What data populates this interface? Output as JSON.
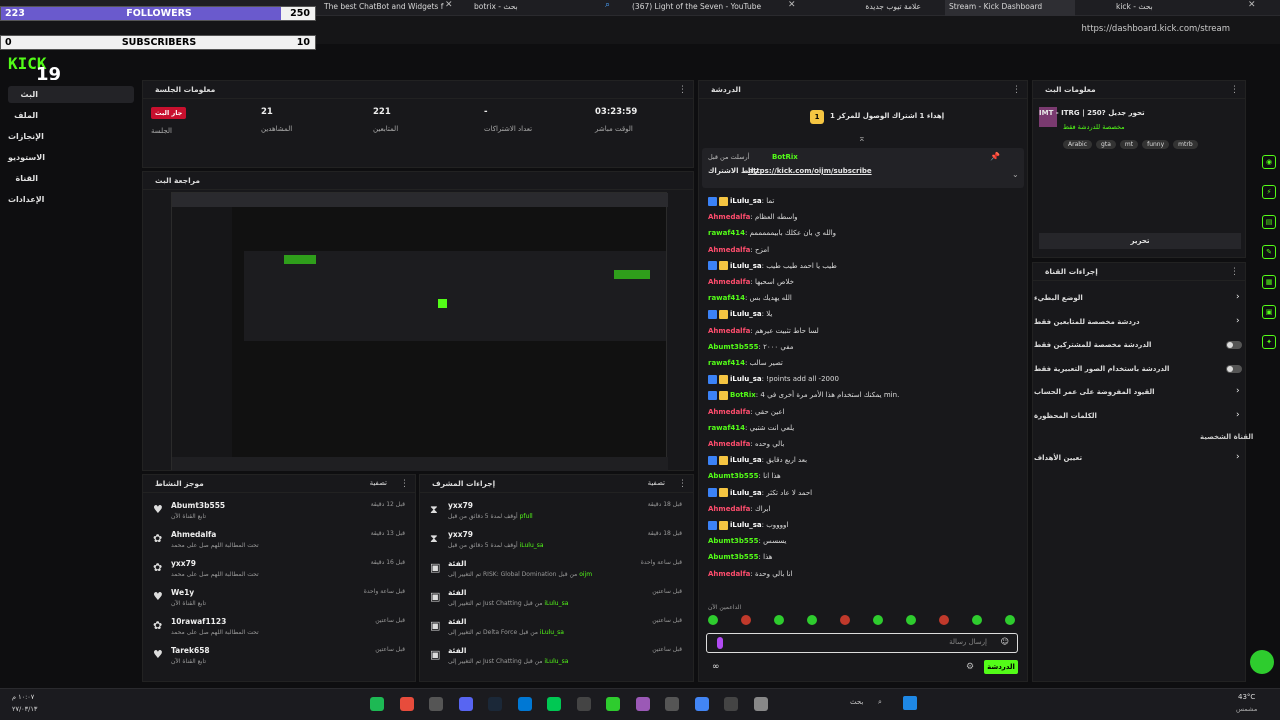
{
  "browser": {
    "tabs": [
      {
        "label": "The best ChatBot and Widgets f"
      },
      {
        "label": "botrix - بحث"
      },
      {
        "label": "(367) Light of the Seven - YouTube"
      },
      {
        "label": "علامة تيوب جديدة"
      },
      {
        "label": "Stream - Kick Dashboard"
      },
      {
        "label": "kick - بحث"
      }
    ],
    "url": "https://dashboard.kick.com/stream"
  },
  "overlay": {
    "followers": {
      "current": "223",
      "label": "FOLLOWERS",
      "goal": "250",
      "progress": 0.892
    },
    "subscribers": {
      "current": "0",
      "label": "SUBSCRIBERS",
      "goal": "10",
      "progress": 0
    }
  },
  "logo": {
    "text": "KICK",
    "counter": "19"
  },
  "sidebar": {
    "items": [
      {
        "label": "البث"
      },
      {
        "label": "الملف"
      },
      {
        "label": "الإنجازات"
      },
      {
        "label": "الاستوديو"
      },
      {
        "label": "القناة"
      },
      {
        "label": "الإعدادات"
      }
    ]
  },
  "session": {
    "title": "معلومات الجلسة",
    "stats": [
      {
        "value": "",
        "label": "الجلسة",
        "badge": "جار البث"
      },
      {
        "value": "21",
        "label": "المشاهدين"
      },
      {
        "value": "221",
        "label": "المتابعين"
      },
      {
        "value": "-",
        "label": "تعداد الاشتراكات"
      },
      {
        "value": "03:23:59",
        "label": "الوقت مباشر"
      }
    ]
  },
  "preview": {
    "title": "مراجعة البث"
  },
  "activity": {
    "title": "موجز النشاط",
    "filter": "تصفية",
    "items": [
      {
        "icon": "heart",
        "name": "Abumt3b555",
        "sub": "تابع القناة الآن",
        "time": "قبل 12 دقيقة"
      },
      {
        "icon": "gift",
        "name": "Ahmedalfa",
        "sub": "تحت المطالبة اللهم صل على محمد",
        "time": "قبل 13 دقيقة"
      },
      {
        "icon": "gift",
        "name": "yxx79",
        "sub": "تحت المطالبة اللهم صل على محمد",
        "time": "قبل 16 دقيقة"
      },
      {
        "icon": "heart",
        "name": "We1y",
        "sub": "تابع القناة الآن",
        "time": "قبل ساعة واحدة"
      },
      {
        "icon": "gift",
        "name": "10rawaf1123",
        "sub": "تحت المطالبة اللهم صل على محمد",
        "time": "قبل ساعتين"
      },
      {
        "icon": "heart",
        "name": "Tarek658",
        "sub": "تابع القناة الآن",
        "time": "قبل ساعتين"
      }
    ]
  },
  "moderation": {
    "title": "إجراءات المشرف",
    "filter": "تصفية",
    "items": [
      {
        "icon": "hourglass",
        "name": "yxx79",
        "sub": "أوقف لمدة 5 دقائق من قبل",
        "who": "pfull",
        "time": "قبل 18 دقيقة"
      },
      {
        "icon": "hourglass",
        "name": "yxx79",
        "sub": "أوقف لمدة 5 دقائق من قبل",
        "who": "iLulu_sa",
        "time": "قبل 18 دقيقة"
      },
      {
        "icon": "box",
        "name": "الفئة",
        "sub": "تم التغيير إلى RISK: Global Domination من قبل",
        "who": "oijm",
        "time": "قبل ساعة واحدة"
      },
      {
        "icon": "box",
        "name": "الفئة",
        "sub": "تم التغيير إلى Just Chatting من قبل",
        "who": "iLulu_sa",
        "time": "قبل ساعتين"
      },
      {
        "icon": "box",
        "name": "الفئة",
        "sub": "تم التغيير إلى Delta Force من قبل",
        "who": "iLulu_sa",
        "time": "قبل ساعتين"
      },
      {
        "icon": "box",
        "name": "الفئة",
        "sub": "تم التغيير إلى Just Chatting من قبل",
        "who": "iLulu_sa",
        "time": "قبل ساعتين"
      }
    ]
  },
  "chat": {
    "title": "الدردشة",
    "pinned_rank": "إهداء 1 اشتراك الوصول للمركز 1",
    "pinned_by": "أرسلت من قبل",
    "pinned_user": "BotRix",
    "pinned_text": "رابط الاشتراك",
    "pinned_link": "https://kick.com/oijm/subscribe",
    "messages": [
      {
        "user": "iLulu_sa",
        "color": "#ffffff",
        "badges": true,
        "text": "تما"
      },
      {
        "user": "Ahmedalfa",
        "color": "#ff4d6d",
        "text": "واسطه العظام"
      },
      {
        "user": "rawaf414",
        "color": "#53fc18",
        "text": "والله ي بان عكلك بابيمممممم"
      },
      {
        "user": "Ahmedalfa",
        "color": "#ff4d6d",
        "text": "امزح"
      },
      {
        "user": "iLulu_sa",
        "color": "#ffffff",
        "badges": true,
        "text": "طيب يا احمد طيب طيب"
      },
      {
        "user": "Ahmedalfa",
        "color": "#ff4d6d",
        "text": "خلاص اسحبها"
      },
      {
        "user": "rawaf414",
        "color": "#53fc18",
        "text": "الله يهديك بس"
      },
      {
        "user": "iLulu_sa",
        "color": "#ffffff",
        "badges": true,
        "text": "يلا"
      },
      {
        "user": "Ahmedalfa",
        "color": "#ff4d6d",
        "text": "لسا حاط تثبيت عيرهم"
      },
      {
        "user": "Abumt3b555",
        "color": "#53fc18",
        "text": "مفي ٢٠٠٠"
      },
      {
        "user": "rawaf414",
        "color": "#53fc18",
        "text": "تصير سالب"
      },
      {
        "user": "iLulu_sa",
        "color": "#ffffff",
        "badges": true,
        "text": "!points add all -2000"
      },
      {
        "user": "BotRix",
        "color": "#53fc18",
        "badges": true,
        "text": "يمكنك استخدام هذا الأمر مرة أخرى في 4 min."
      },
      {
        "user": "Ahmedalfa",
        "color": "#ff4d6d",
        "text": "اعين حقي"
      },
      {
        "user": "rawaf414",
        "color": "#53fc18",
        "text": "يلعي انت شتبي"
      },
      {
        "user": "Ahmedalfa",
        "color": "#ff4d6d",
        "text": "بالي وحده"
      },
      {
        "user": "iLulu_sa",
        "color": "#ffffff",
        "badges": true,
        "text": "بعد اربع دقايق"
      },
      {
        "user": "Abumt3b555",
        "color": "#53fc18",
        "text": "هذا انا"
      },
      {
        "user": "iLulu_sa",
        "color": "#ffffff",
        "badges": true,
        "text": "احمد لا عاد تكثر"
      },
      {
        "user": "Ahmedalfa",
        "color": "#ff4d6d",
        "text": "ابراك"
      },
      {
        "user": "iLulu_sa",
        "color": "#ffffff",
        "badges": true,
        "text": "اووووب"
      },
      {
        "user": "Abumt3b555",
        "color": "#53fc18",
        "text": "يسسس"
      },
      {
        "user": "Abumt3b555",
        "color": "#53fc18",
        "text": "هذا"
      },
      {
        "user": "Ahmedalfa",
        "color": "#ff4d6d",
        "text": "انا بالي وحدة"
      }
    ],
    "input_placeholder": "إرسال رسالة",
    "send_label": "الدردشة",
    "supporters_label": "الداعمين الآن"
  },
  "stream_info": {
    "title": "معلومات البث",
    "stream_title": "IMT - ITRG | 250? تحور جديل",
    "category": "مخصصة للدردشة فقط",
    "tags": [
      "Arabic",
      "gta",
      "mt",
      "funny",
      "mtrb"
    ],
    "edit_label": "تحرير"
  },
  "channel_actions": {
    "title": "إجراءات القناة",
    "rows": [
      {
        "label": "الوضع البطيء",
        "type": "chevron"
      },
      {
        "label": "دردشة مخصصة للمتابعين فقط",
        "type": "chevron"
      },
      {
        "label": "الدردشة مخصصة للمشتركين فقط",
        "type": "toggle"
      },
      {
        "label": "الدردشة باستخدام الصور التعبيرية فقط",
        "type": "toggle"
      },
      {
        "label": "القيود المفروضة على عمر الحساب",
        "type": "chevron"
      },
      {
        "label": "الكلمات المحظورة",
        "type": "chevron"
      }
    ],
    "personal_label": "القناة الشخصية",
    "goals_label": "تعيين الأهداف"
  },
  "taskbar": {
    "search": "بحث",
    "temp": "43°C",
    "weather": "مشمس",
    "time": "١٠:٠٧ م",
    "date": "٢٧/٠٣/١٣"
  },
  "colors": {
    "accent": "#53fc18",
    "live": "#c8102e",
    "panel": "#18181b"
  }
}
